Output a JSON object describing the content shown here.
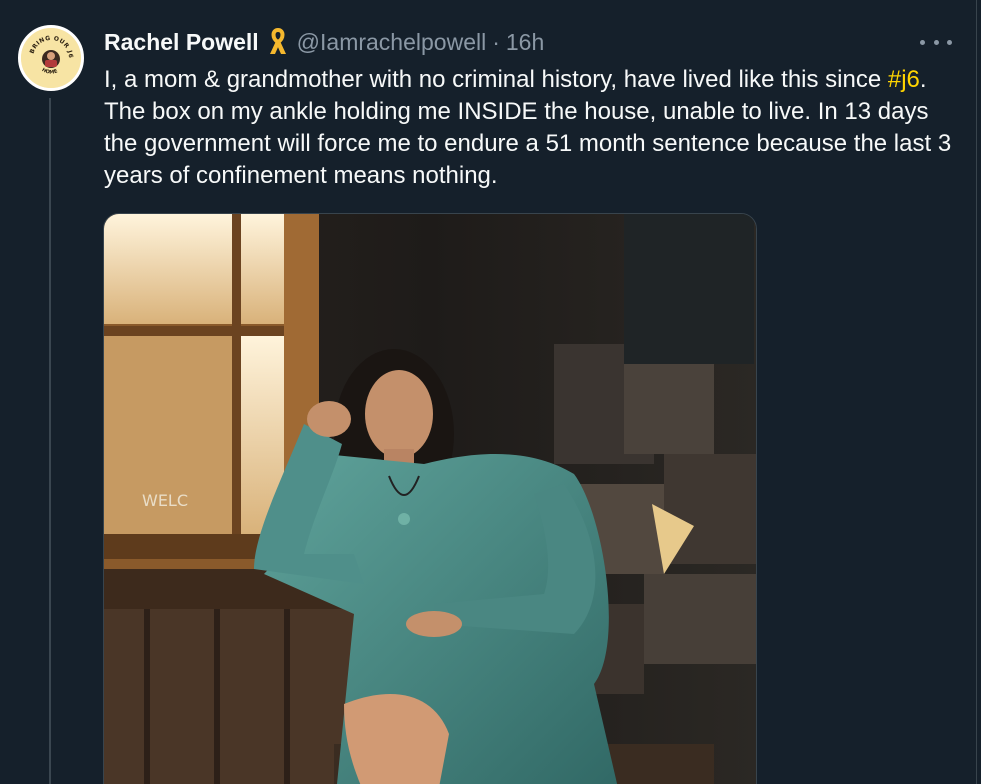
{
  "tweet": {
    "author": {
      "display_name": "Rachel Powell",
      "handle": "@Iamrachelpowell",
      "separator": "·",
      "time": "16h",
      "badge_icon": "yellow-ribbon-icon",
      "avatar_text": "BRING OUR J6ERS HOME"
    },
    "text": {
      "before_hashtag": "I, a mom & grandmother with no criminal history, have lived like this since ",
      "hashtag": "#j6",
      "after_hashtag": ". The box on my ankle holding me INSIDE the house, unable to live. In 13 days the government will force me to endure a 51 month sentence because the last 3 years of confinement means nothing."
    },
    "more_icon": "more-horizontal-icon",
    "media": {
      "sign_text": "WELC"
    }
  },
  "colors": {
    "background": "#15202b",
    "text": "#f7f9f9",
    "secondary": "#8b98a5",
    "hashtag": "#ffd400",
    "border": "#38444d",
    "dress": "#4f8f8a"
  }
}
